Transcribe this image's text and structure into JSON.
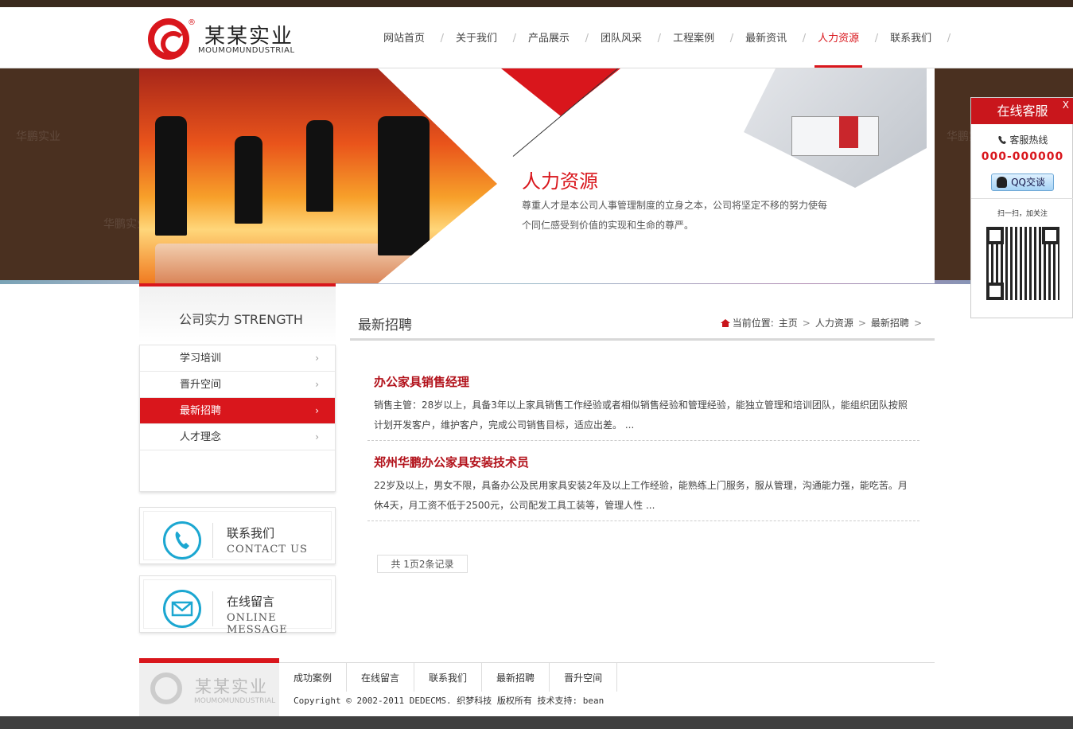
{
  "brand": {
    "name_cn": "某某实业",
    "name_en": "MOUMOMUNDUSTRIAL",
    "reg_mark": "®"
  },
  "nav": {
    "items": [
      {
        "label": "网站首页"
      },
      {
        "label": "关于我们"
      },
      {
        "label": "产品展示"
      },
      {
        "label": "团队风采"
      },
      {
        "label": "工程案例"
      },
      {
        "label": "最新资讯"
      },
      {
        "label": "人力资源",
        "active": true
      },
      {
        "label": "联系我们"
      }
    ]
  },
  "banner": {
    "title": "人力资源",
    "desc": "尊重人才是本公司人事管理制度的立身之本，公司将坚定不移的努力使每个同仁感受到价值的实现和生命的尊严。",
    "watermark": "华鹏实业"
  },
  "sidebar": {
    "title": "公司实力 STRENGTH",
    "items": [
      {
        "label": "学习培训"
      },
      {
        "label": "晋升空间"
      },
      {
        "label": "最新招聘",
        "active": true
      },
      {
        "label": "人才理念"
      }
    ],
    "arrow": "›"
  },
  "contact_boxes": [
    {
      "cn": "联系我们",
      "en": "CONTACT  US",
      "icon": "phone-icon"
    },
    {
      "cn": "在线留言",
      "en": "ONLINE  MESSAGE",
      "icon": "mail-icon"
    }
  ],
  "content": {
    "title": "最新招聘",
    "breadcrumb": {
      "prefix": "当前位置:",
      "items": [
        "主页",
        "人力资源",
        "最新招聘"
      ],
      "sep": ">"
    },
    "jobs": [
      {
        "title": "办公家具销售经理",
        "desc": "销售主管：28岁以上，具备3年以上家具销售工作经验或者相似销售经验和管理经验，能独立管理和培训团队，能组织团队按照计划开发客户，维护客户，完成公司销售目标，适应出差。 ..."
      },
      {
        "title": "郑州华鹏办公家具安装技术员",
        "desc": "22岁及以上，男女不限，具备办公及民用家具安装2年及以上工作经验，能熟练上门服务，服从管理，沟通能力强，能吃苦。月休4天，月工资不低于2500元，公司配发工具工装等，管理人性 ..."
      }
    ],
    "pager": "共 1页2条记录"
  },
  "footer": {
    "links": [
      "成功案例",
      "在线留言",
      "联系我们",
      "最新招聘",
      "晋升空间"
    ],
    "copyright": "Copyright © 2002-2011 DEDECMS. 织梦科技 版权所有 技术支持: bean"
  },
  "kefu": {
    "title": "在线客服",
    "close": "X",
    "hotline_label": "客服热线",
    "phone": "000-000000",
    "qq_label": "QQ交谈",
    "scan_text": "扫一扫，加关注"
  },
  "colors": {
    "accent": "#d9161c",
    "dark_bar": "#3a2a1e"
  }
}
